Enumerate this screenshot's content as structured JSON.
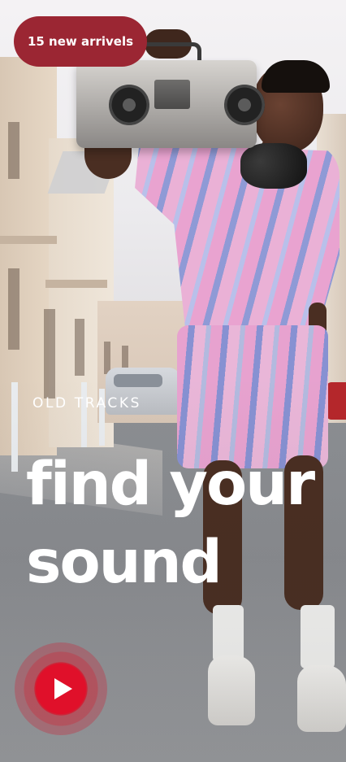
{
  "badge": {
    "label": "15 new arrivels"
  },
  "hero": {
    "eyebrow": "OLD TRACKS",
    "headline_line1": "find your",
    "headline_line2": "sound"
  },
  "player": {
    "icon": "play-icon"
  },
  "colors": {
    "badge_bg": "#9b2633",
    "play_red": "#e0102a",
    "text": "#ffffff"
  }
}
